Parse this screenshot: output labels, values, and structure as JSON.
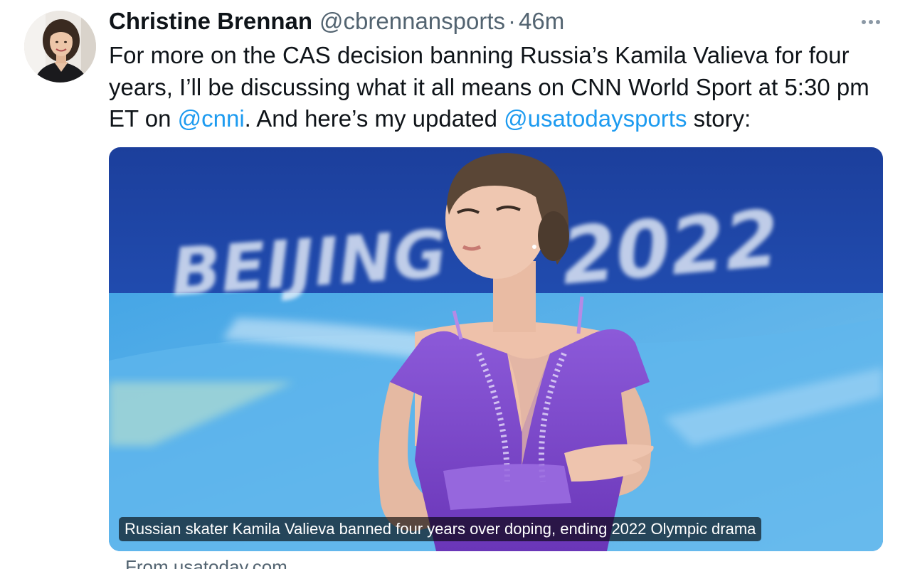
{
  "tweet": {
    "author": {
      "display_name": "Christine Brennan",
      "handle": "@cbrennansports"
    },
    "separator": "·",
    "timestamp": "46m",
    "text": {
      "part1": "For more on the CAS decision banning Russia’s Kamila Valieva for four years, I’ll be discussing what it all means on CNN World Sport at 5:30 pm ET on ",
      "mention1": "@cnni",
      "part2": ". And here’s my updated ",
      "mention2": "@usatodaysports",
      "part3": " story:"
    },
    "card": {
      "caption": "Russian skater Kamila Valieva banned four years over doping, ending 2022 Olympic drama",
      "source": "From usatoday.com",
      "background_sign_text": "BEIJING 2022"
    },
    "icons": {
      "more": "more-horizontal-icon"
    },
    "colors": {
      "link": "#1d9bf0",
      "secondary_text": "#536471",
      "primary_text": "#0f1419"
    }
  }
}
